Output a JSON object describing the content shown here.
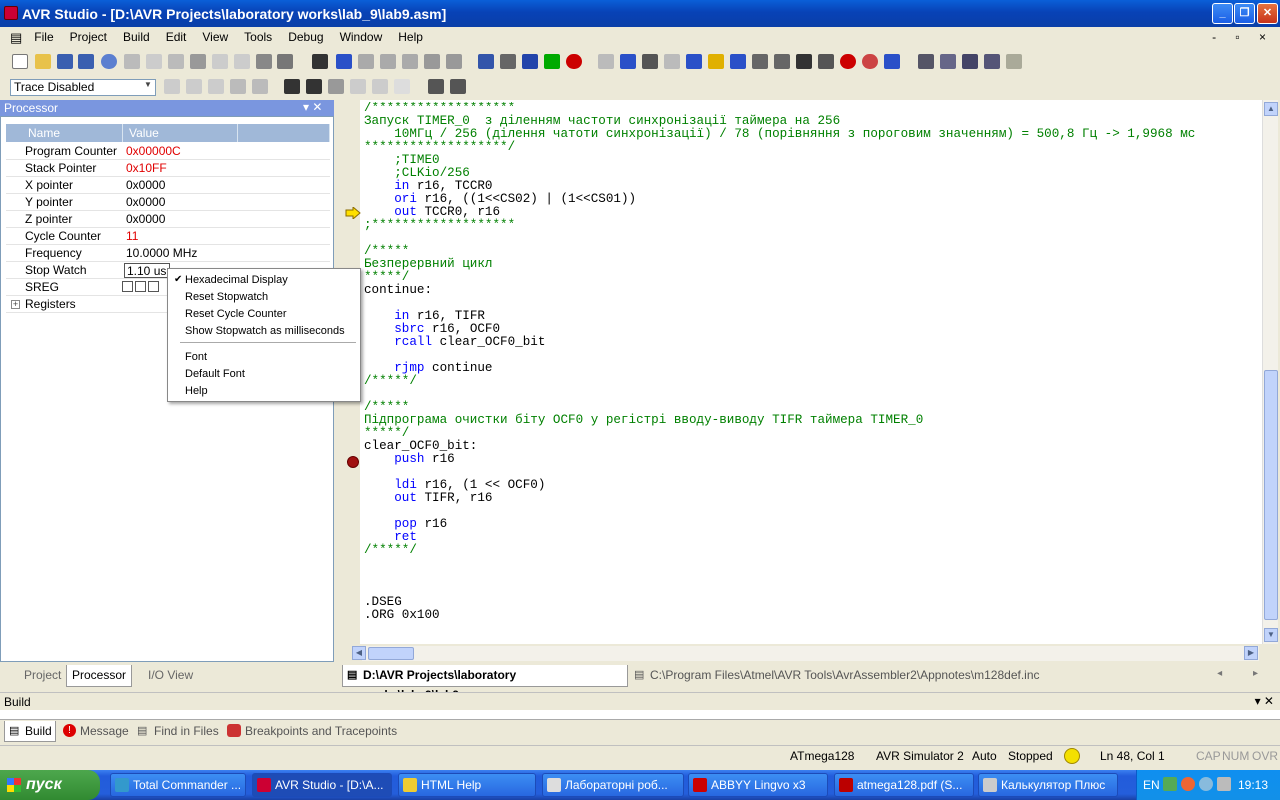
{
  "window": {
    "title": "AVR Studio - [D:\\AVR Projects\\laboratory works\\lab_9\\lab9.asm]",
    "controls": [
      "_",
      "❐",
      "✕"
    ]
  },
  "menu": [
    "File",
    "Project",
    "Build",
    "Edit",
    "View",
    "Tools",
    "Debug",
    "Window",
    "Help"
  ],
  "mdi_controls": "-  ▫  ×",
  "trace": {
    "selected": "Trace Disabled"
  },
  "processor": {
    "title": "Processor",
    "header_buttons": "▾  ✕",
    "columns": {
      "name": "Name",
      "value": "Value"
    },
    "rows": [
      {
        "name": "Program Counter",
        "value": "0x00000C",
        "changed": true
      },
      {
        "name": "Stack Pointer",
        "value": "0x10FF",
        "changed": true
      },
      {
        "name": "X pointer",
        "value": "0x0000",
        "changed": false
      },
      {
        "name": "Y pointer",
        "value": "0x0000",
        "changed": false
      },
      {
        "name": "Z pointer",
        "value": "0x0000",
        "changed": false
      },
      {
        "name": "Cycle Counter",
        "value": "11",
        "changed": true
      },
      {
        "name": "Frequency",
        "value": "10.0000 MHz",
        "changed": false
      },
      {
        "name": "Stop Watch",
        "value": "1.10 us",
        "changed": false
      },
      {
        "name": "SREG",
        "value": "",
        "changed": false
      },
      {
        "name": "Registers",
        "value": "",
        "changed": false
      }
    ]
  },
  "context_menu": {
    "items": [
      "Hexadecimal Display",
      "Reset Stopwatch",
      "Reset Cycle Counter",
      "Show Stopwatch as milliseconds",
      "Font",
      "Default Font",
      "Help"
    ],
    "checked": "Hexadecimal Display"
  },
  "left_tabs": [
    "Project",
    "Processor",
    "I/O View"
  ],
  "editor": {
    "lines": [
      [
        [
          "c-comment",
          "/*******************"
        ]
      ],
      [
        [
          "c-comment",
          "Запуск TIMER_0  з діленням частоти синхронізації таймера на 256"
        ]
      ],
      [
        [
          "c-comment",
          "    10МГц / 256 (ділення чатоти синхронізації) / 78 (порівняння з пороговим значенням) = 500,8 Гц -> 1,9968 мс"
        ]
      ],
      [
        [
          "c-comment",
          "*******************/"
        ]
      ],
      [
        [
          "c-comment",
          "    ;TIME0"
        ]
      ],
      [
        [
          "c-comment",
          "    ;CLKio/256"
        ]
      ],
      [
        [
          "c-kw",
          "    in"
        ],
        [
          "c-plain",
          " r16, TCCR0"
        ]
      ],
      [
        [
          "c-kw",
          "    ori"
        ],
        [
          "c-plain",
          " r16, ((1<<CS02) | (1<<CS01))"
        ]
      ],
      [
        [
          "c-kw",
          "    out"
        ],
        [
          "c-plain",
          " TCCR0, r16"
        ]
      ],
      [
        [
          "c-comment",
          ";*******************"
        ]
      ],
      [
        [
          "c-plain",
          ""
        ]
      ],
      [
        [
          "c-comment",
          "/*****"
        ]
      ],
      [
        [
          "c-comment",
          "Безперервний цикл"
        ]
      ],
      [
        [
          "c-comment",
          "*****/"
        ]
      ],
      [
        [
          "c-plain",
          "continue:"
        ]
      ],
      [
        [
          "c-plain",
          ""
        ]
      ],
      [
        [
          "c-kw",
          "    in"
        ],
        [
          "c-plain",
          " r16, TIFR"
        ]
      ],
      [
        [
          "c-kw",
          "    sbrc"
        ],
        [
          "c-plain",
          " r16, OCF0"
        ]
      ],
      [
        [
          "c-kw",
          "    rcall"
        ],
        [
          "c-plain",
          " clear_OCF0_bit"
        ]
      ],
      [
        [
          "c-plain",
          ""
        ]
      ],
      [
        [
          "c-kw",
          "    rjmp"
        ],
        [
          "c-plain",
          " continue"
        ]
      ],
      [
        [
          "c-comment",
          "/*****/"
        ]
      ],
      [
        [
          "c-plain",
          ""
        ]
      ],
      [
        [
          "c-comment",
          "/*****"
        ]
      ],
      [
        [
          "c-comment",
          "Підпрограма очистки біту OCF0 у регістрі вводу-виводу TIFR таймера TIMER_0"
        ]
      ],
      [
        [
          "c-comment",
          "*****/"
        ]
      ],
      [
        [
          "c-plain",
          "clear_OCF0_bit:"
        ]
      ],
      [
        [
          "c-kw",
          "    push"
        ],
        [
          "c-plain",
          " r16"
        ]
      ],
      [
        [
          "c-plain",
          ""
        ]
      ],
      [
        [
          "c-kw",
          "    ldi"
        ],
        [
          "c-plain",
          " r16, (1 << OCF0)"
        ]
      ],
      [
        [
          "c-kw",
          "    out"
        ],
        [
          "c-plain",
          " TIFR, r16"
        ]
      ],
      [
        [
          "c-plain",
          ""
        ]
      ],
      [
        [
          "c-kw",
          "    pop"
        ],
        [
          "c-plain",
          " r16"
        ]
      ],
      [
        [
          "c-kw",
          "    ret"
        ]
      ],
      [
        [
          "c-comment",
          "/*****/"
        ]
      ],
      [
        [
          "c-plain",
          ""
        ]
      ],
      [
        [
          "c-plain",
          ""
        ]
      ],
      [
        [
          "c-plain",
          ""
        ]
      ],
      [
        [
          "c-plain",
          ".DSEG"
        ]
      ],
      [
        [
          "c-plain",
          ".ORG 0x100"
        ]
      ]
    ]
  },
  "editor_tabs": [
    "D:\\AVR Projects\\laboratory works\\lab_9\\lab9.asm",
    "C:\\Program Files\\Atmel\\AVR Tools\\AvrAssembler2\\Appnotes\\m128def.inc"
  ],
  "editor_tab_nav": "◂ ▸",
  "build": {
    "title": "Build",
    "header_buttons": "▾  ✕",
    "tabs": [
      "Build",
      "Message",
      "Find in Files",
      "Breakpoints and Tracepoints"
    ]
  },
  "status": {
    "device": "ATmega128",
    "platform": "AVR Simulator 2",
    "mode": "Auto",
    "state": "Stopped",
    "position": "Ln 48, Col 1",
    "caps": "CAP",
    "num": "NUM",
    "ovr": "OVR"
  },
  "taskbar": {
    "start": "пуск",
    "tasks": [
      "Total Commander ...",
      "AVR Studio - [D:\\A...",
      "HTML Help",
      "Лабораторні роб...",
      "ABBYY Lingvo x3",
      "atmega128.pdf (S...",
      "Калькулятор Плюс"
    ],
    "lang": "EN",
    "clock": "19:13"
  },
  "colors": {
    "changed_value": "#e00000",
    "comment": "#008000",
    "keyword": "#0000ff",
    "title_bar": "#0842b6",
    "taskbar": "#245edb",
    "start": "#318a31"
  }
}
